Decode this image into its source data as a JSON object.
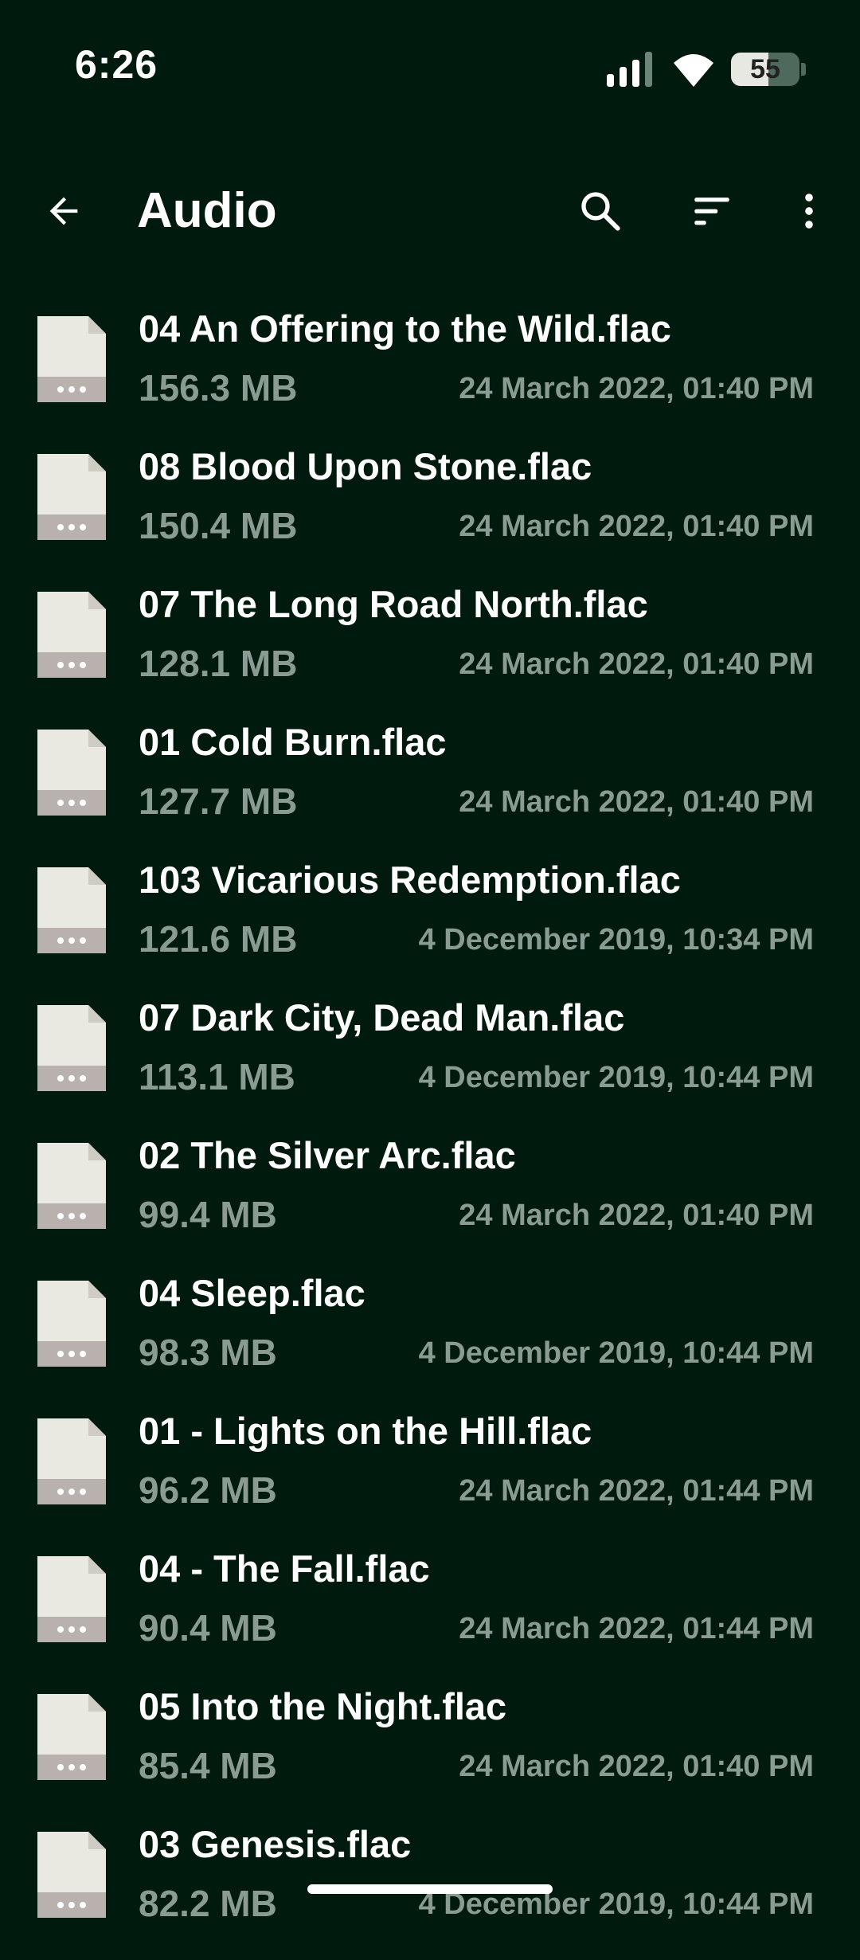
{
  "status_bar": {
    "time": "6:26",
    "battery": "55",
    "battery_level": 0.55
  },
  "app_bar": {
    "title": "Audio"
  },
  "files": [
    {
      "name": "04 An Offering to the Wild.flac",
      "size": "156.3 MB",
      "date": "24 March 2022, 01:40 PM"
    },
    {
      "name": "08 Blood Upon Stone.flac",
      "size": "150.4 MB",
      "date": "24 March 2022, 01:40 PM"
    },
    {
      "name": "07 The Long Road North.flac",
      "size": "128.1 MB",
      "date": "24 March 2022, 01:40 PM"
    },
    {
      "name": "01 Cold Burn.flac",
      "size": "127.7 MB",
      "date": "24 March 2022, 01:40 PM"
    },
    {
      "name": "103 Vicarious Redemption.flac",
      "size": "121.6 MB",
      "date": "4 December 2019, 10:34 PM"
    },
    {
      "name": "07 Dark City, Dead Man.flac",
      "size": "113.1 MB",
      "date": "4 December 2019, 10:44 PM"
    },
    {
      "name": "02 The Silver Arc.flac",
      "size": "99.4 MB",
      "date": "24 March 2022, 01:40 PM"
    },
    {
      "name": "04 Sleep.flac",
      "size": "98.3 MB",
      "date": "4 December 2019, 10:44 PM"
    },
    {
      "name": "01 - Lights on the Hill.flac",
      "size": "96.2 MB",
      "date": "24 March 2022, 01:44 PM"
    },
    {
      "name": "04 - The Fall.flac",
      "size": "90.4 MB",
      "date": "24 March 2022, 01:44 PM"
    },
    {
      "name": "05 Into the Night.flac",
      "size": "85.4 MB",
      "date": "24 March 2022, 01:40 PM"
    },
    {
      "name": "03 Genesis.flac",
      "size": "82.2 MB",
      "date": "4 December 2019, 10:44 PM"
    }
  ],
  "icons": {
    "back": "arrow-back-icon",
    "search": "search-icon",
    "sort": "sort-icon",
    "more": "more-vert-icon",
    "file": "file-icon"
  },
  "colors": {
    "background": "#011a0e",
    "primary_text": "#ffffff",
    "secondary_text": "#8a9b92",
    "file_icon_body": "#e9e8e1",
    "file_icon_band": "#b8b1ad"
  }
}
